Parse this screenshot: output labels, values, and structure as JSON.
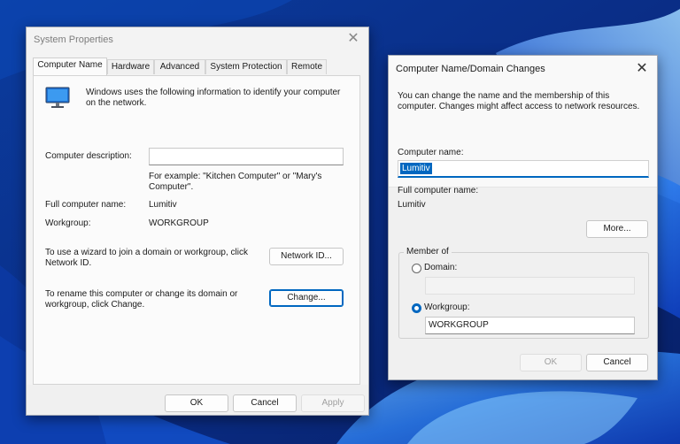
{
  "system_properties": {
    "title": "System Properties",
    "tabs": [
      {
        "label": "Computer Name",
        "active": true
      },
      {
        "label": "Hardware",
        "active": false
      },
      {
        "label": "Advanced",
        "active": false
      },
      {
        "label": "System Protection",
        "active": false
      },
      {
        "label": "Remote",
        "active": false
      }
    ],
    "intro_text": "Windows uses the following information to identify your computer on the network.",
    "computer_description_label": "Computer description:",
    "computer_description_value": "",
    "example_text": "For example: \"Kitchen Computer\" or \"Mary's Computer\".",
    "full_computer_name_label": "Full computer name:",
    "full_computer_name_value": "Lumitiv",
    "workgroup_label": "Workgroup:",
    "workgroup_value": "WORKGROUP",
    "network_id_text": "To use a wizard to join a domain or workgroup, click Network ID.",
    "network_id_button": "Network ID...",
    "rename_text": "To rename this computer or change its domain or workgroup, click Change.",
    "change_button": "Change...",
    "ok_button": "OK",
    "cancel_button": "Cancel",
    "apply_button": "Apply"
  },
  "name_changes": {
    "title": "Computer Name/Domain Changes",
    "intro_text": "You can change the name and the membership of this computer. Changes might affect access to network resources.",
    "computer_name_label": "Computer name:",
    "computer_name_value": "Lumitiv",
    "full_computer_name_label": "Full computer name:",
    "full_computer_name_value": "Lumitiv",
    "more_button": "More...",
    "member_of_label": "Member of",
    "domain_label": "Domain:",
    "domain_value": "",
    "domain_selected": false,
    "workgroup_label": "Workgroup:",
    "workgroup_value": "WORKGROUP",
    "workgroup_selected": true,
    "ok_button": "OK",
    "cancel_button": "Cancel"
  },
  "colors": {
    "accent": "#0067c0",
    "wallpaper_dark": "#0a2a7a",
    "wallpaper_light": "#4fa3f5"
  }
}
